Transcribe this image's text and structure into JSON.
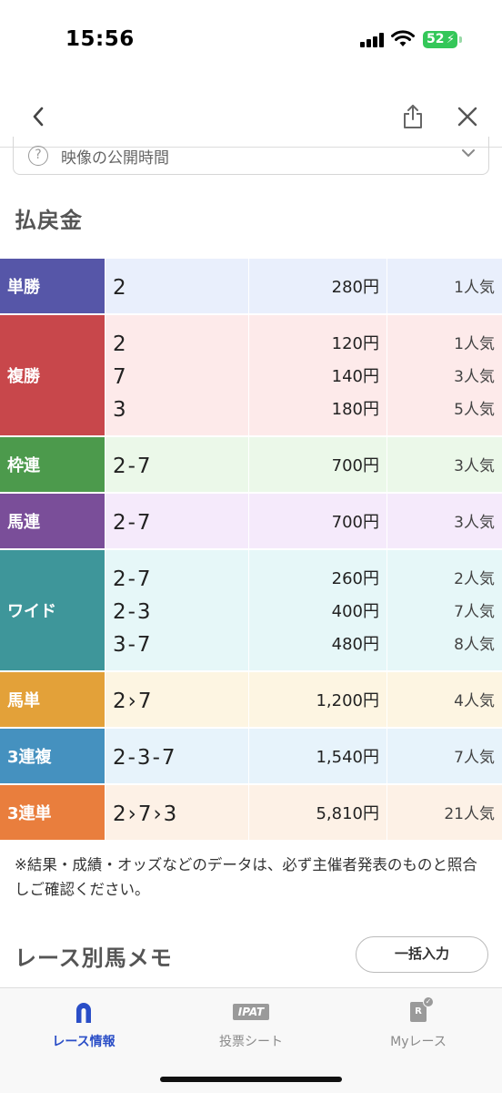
{
  "status_bar": {
    "time": "15:56",
    "battery": "52"
  },
  "video_time": {
    "label": "映像の公開時間"
  },
  "section_title": "払戻金",
  "payouts": [
    {
      "type": "単勝",
      "color": "#5656a8",
      "bg": "#e9effc",
      "lines": [
        {
          "combo": "2",
          "payout": "280円",
          "popularity": "1人気"
        }
      ]
    },
    {
      "type": "複勝",
      "color": "#c8474b",
      "bg": "#fdeaea",
      "lines": [
        {
          "combo": "2",
          "payout": "120円",
          "popularity": "1人気"
        },
        {
          "combo": "7",
          "payout": "140円",
          "popularity": "3人気"
        },
        {
          "combo": "3",
          "payout": "180円",
          "popularity": "5人気"
        }
      ]
    },
    {
      "type": "枠連",
      "color": "#4c9a4c",
      "bg": "#ebf8e9",
      "lines": [
        {
          "combo": "2-7",
          "payout": "700円",
          "popularity": "3人気"
        }
      ]
    },
    {
      "type": "馬連",
      "color": "#7a4e99",
      "bg": "#f5eafb",
      "lines": [
        {
          "combo": "2-7",
          "payout": "700円",
          "popularity": "3人気"
        }
      ]
    },
    {
      "type": "ワイド",
      "color": "#3e969a",
      "bg": "#e6f7f8",
      "lines": [
        {
          "combo": "2-7",
          "payout": "260円",
          "popularity": "2人気"
        },
        {
          "combo": "2-3",
          "payout": "400円",
          "popularity": "7人気"
        },
        {
          "combo": "3-7",
          "payout": "480円",
          "popularity": "8人気"
        }
      ]
    },
    {
      "type": "馬単",
      "color": "#e3a139",
      "bg": "#fdf5e2",
      "lines": [
        {
          "combo": "2›7",
          "payout": "1,200円",
          "popularity": "4人気"
        }
      ]
    },
    {
      "type": "3連複",
      "color": "#4591bf",
      "bg": "#e7f3fb",
      "lines": [
        {
          "combo": "2-3-7",
          "payout": "1,540円",
          "popularity": "7人気"
        }
      ]
    },
    {
      "type": "3連単",
      "color": "#e97e3d",
      "bg": "#fdf1e6",
      "lines": [
        {
          "combo": "2›7›3",
          "payout": "5,810円",
          "popularity": "21人気"
        }
      ]
    }
  ],
  "note": "※結果・成績・オッズなどのデータは、必ず主催者発表のものと照合しご確認ください。",
  "memo": {
    "title": "レース別馬メモ",
    "bulk_button": "一括入力"
  },
  "tabs": [
    {
      "label": "レース情報",
      "icon": "horseshoe-icon",
      "active": true
    },
    {
      "label": "投票シート",
      "icon": "ipat-icon",
      "active": false
    },
    {
      "label": "Myレース",
      "icon": "my-race-icon",
      "active": false
    }
  ],
  "ipat_icon_text": "IPAT",
  "my_race_icon_text": "R"
}
